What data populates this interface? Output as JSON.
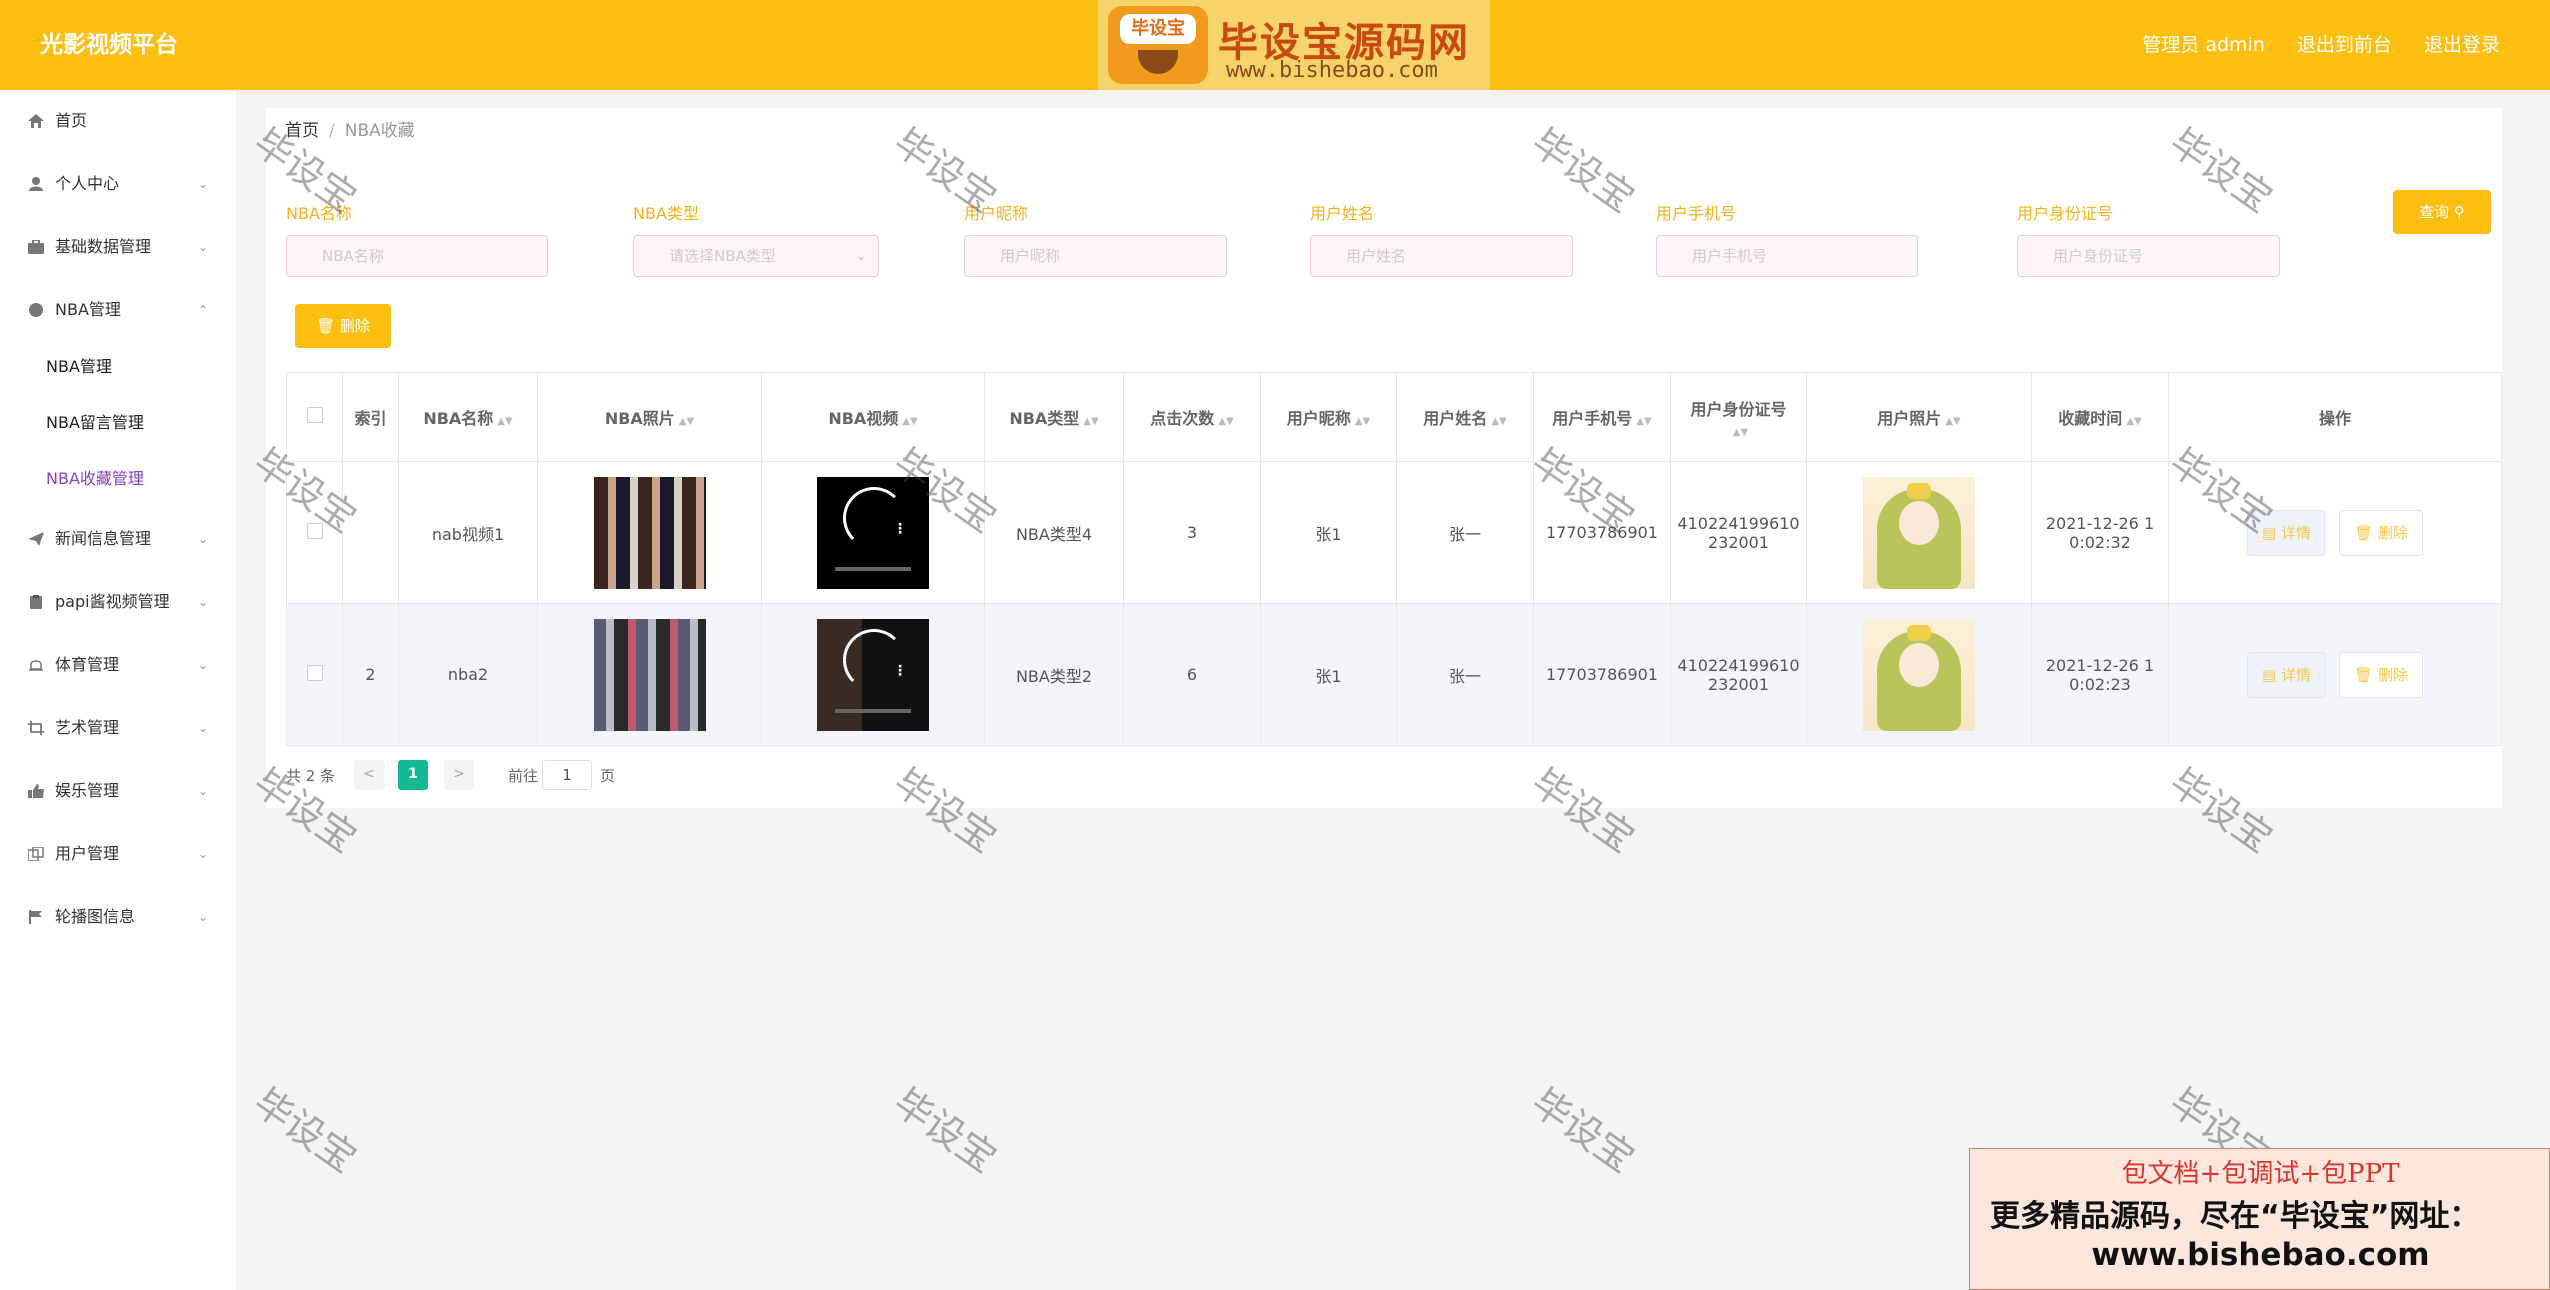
{
  "app": {
    "title": "光影视频平台",
    "nav": [
      "管理员 admin",
      "退出到前台",
      "退出登录"
    ]
  },
  "watermark_logo": {
    "badge": "毕设宝",
    "title": "毕设宝源码网",
    "url": "www.bishebao.com"
  },
  "sidebar": {
    "items": [
      {
        "label": "首页",
        "icon": "home-icon"
      },
      {
        "label": "个人中心",
        "icon": "user-icon"
      },
      {
        "label": "基础数据管理",
        "icon": "briefcase-icon"
      },
      {
        "label": "NBA管理",
        "icon": "ball-icon"
      },
      {
        "label": "新闻信息管理",
        "icon": "send-icon"
      },
      {
        "label": "papi酱视频管理",
        "icon": "clipboard-icon"
      },
      {
        "label": "体育管理",
        "icon": "bell-icon"
      },
      {
        "label": "艺术管理",
        "icon": "crop-icon"
      },
      {
        "label": "娱乐管理",
        "icon": "thumbs-up-icon"
      },
      {
        "label": "用户管理",
        "icon": "copy-icon"
      },
      {
        "label": "轮播图信息",
        "icon": "flag-icon"
      }
    ],
    "sub": [
      "NBA管理",
      "NBA留言管理",
      "NBA收藏管理"
    ]
  },
  "breadcrumb": {
    "home": "首页",
    "sep": "/",
    "current": "NBA收藏"
  },
  "filters": [
    {
      "label": "NBA名称",
      "placeholder": "NBA名称"
    },
    {
      "label": "NBA类型",
      "placeholder": "请选择NBA类型"
    },
    {
      "label": "用户昵称",
      "placeholder": "用户昵称"
    },
    {
      "label": "用户姓名",
      "placeholder": "用户姓名"
    },
    {
      "label": "用户手机号",
      "placeholder": "用户手机号"
    },
    {
      "label": "用户身份证号",
      "placeholder": "用户身份证号"
    }
  ],
  "buttons": {
    "search": "查询",
    "delete": "删除"
  },
  "table": {
    "headers": [
      "索引",
      "NBA名称",
      "NBA照片",
      "NBA视频",
      "NBA类型",
      "点击次数",
      "用户昵称",
      "用户姓名",
      "用户手机号",
      "用户身份证号",
      "用户照片",
      "收藏时间",
      "操作"
    ],
    "rows": [
      {
        "index": "",
        "name": "nab视频1",
        "type": "NBA类型4",
        "clicks": "3",
        "nick": "张1",
        "realname": "张一",
        "phone": "17703786901",
        "idcard_1": "410224199610",
        "idcard_2": "232001",
        "time_1": "2021-12-26 1",
        "time_2": "0:02:32"
      },
      {
        "index": "2",
        "name": "nba2",
        "type": "NBA类型2",
        "clicks": "6",
        "nick": "张1",
        "realname": "张一",
        "phone": "17703786901",
        "idcard_1": "410224199610",
        "idcard_2": "232001",
        "time_1": "2021-12-26 1",
        "time_2": "0:02:23"
      }
    ],
    "op_detail": "详情",
    "op_delete": "删除"
  },
  "pagination": {
    "total": "共 2 条",
    "prev": "<",
    "current": "1",
    "next": ">",
    "goto": "前往",
    "page_value": "1",
    "unit": "页"
  },
  "watermark_text": "毕设宝",
  "ad": {
    "line1": "包文档+包调试+包PPT",
    "line2": "更多精品源码，尽在“毕设宝”网址：",
    "line3": "www.bishebao.com"
  }
}
